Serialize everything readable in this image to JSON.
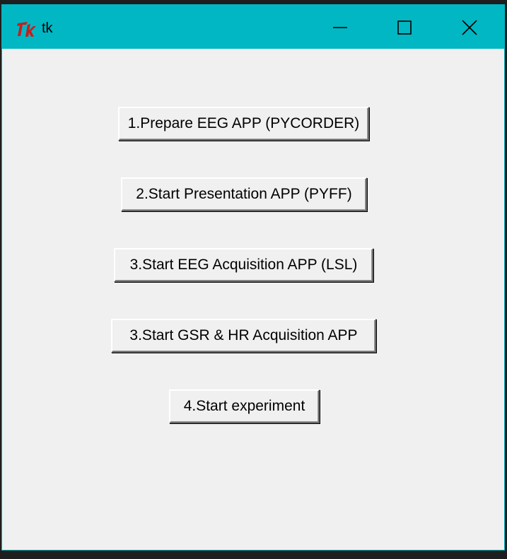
{
  "window": {
    "title": "tk",
    "titlebar_color": "#00b7c3",
    "client_color": "#f0f0f0",
    "icon": "tk-feather-icon",
    "controls": {
      "minimize_icon": "minimize-icon",
      "maximize_icon": "maximize-icon",
      "close_icon": "close-icon"
    }
  },
  "buttons": [
    {
      "label": "1.Prepare EEG APP (PYCORDER)"
    },
    {
      "label": "2.Start Presentation APP (PYFF)"
    },
    {
      "label": "3.Start EEG Acquisition APP (LSL)"
    },
    {
      "label": "3.Start GSR & HR Acquisition APP"
    },
    {
      "label": "4.Start experiment"
    }
  ]
}
